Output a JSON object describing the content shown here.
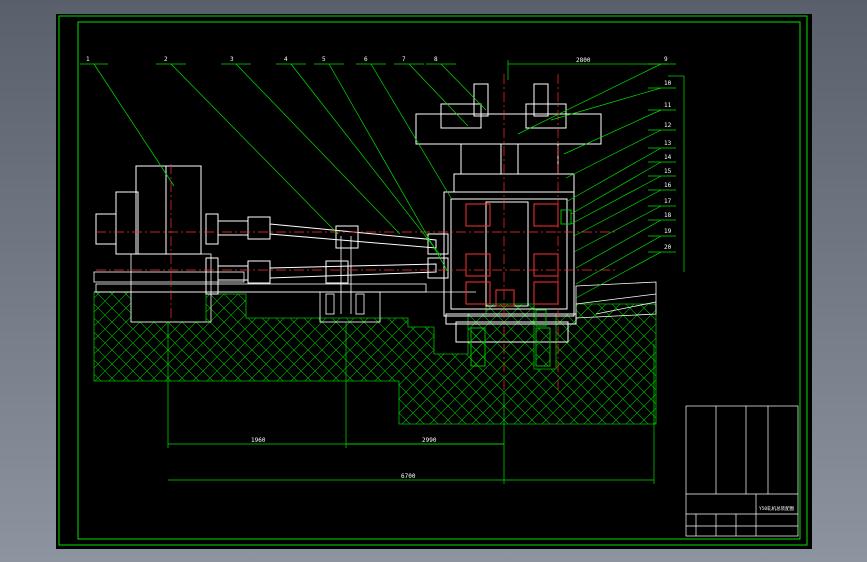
{
  "callouts": [
    "1",
    "2",
    "3",
    "4",
    "5",
    "6",
    "7",
    "8",
    "9",
    "10",
    "11",
    "12",
    "13",
    "14",
    "15",
    "16",
    "17",
    "18",
    "19",
    "20"
  ],
  "dimensions": [
    "1960",
    "2990",
    "6700",
    "2800"
  ],
  "title_block": {
    "drawing_title": "Y50轧机总装配图",
    "bottom_row": [
      "",
      "",
      "",
      ""
    ]
  },
  "colors": {
    "frame": "#00e000",
    "structure": "#ffffff",
    "centerline": "#ff3030",
    "accent": "#ff3030",
    "green": "#00d000",
    "background": "#000000",
    "viewport_bg": "#6a7280"
  }
}
